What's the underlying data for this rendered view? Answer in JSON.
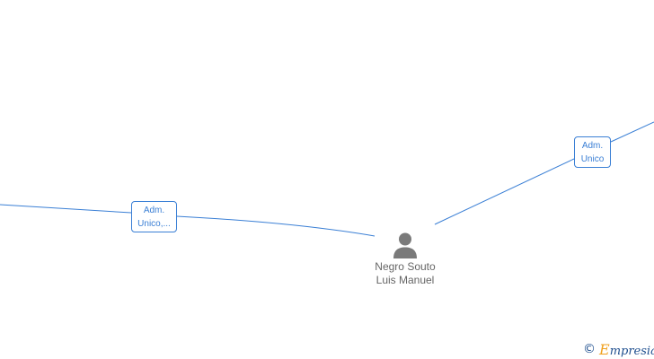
{
  "diagram": {
    "node": {
      "icon": "person-icon",
      "name_line1": "Negro Souto",
      "name_line2": "Luis Manuel"
    },
    "edges": [
      {
        "label_line1": "Adm.",
        "label_line2": "Unico,..."
      },
      {
        "label_line1": "Adm.",
        "label_line2": "Unico"
      }
    ]
  },
  "watermark": {
    "icon": "copyright-icon",
    "brand": "Empresia"
  },
  "colors": {
    "edge": "#3a7fd5",
    "node_icon": "#7a7a7a",
    "node_text": "#666666",
    "brand_initial": "#f0a01e",
    "brand_text": "#1f4f8f"
  }
}
